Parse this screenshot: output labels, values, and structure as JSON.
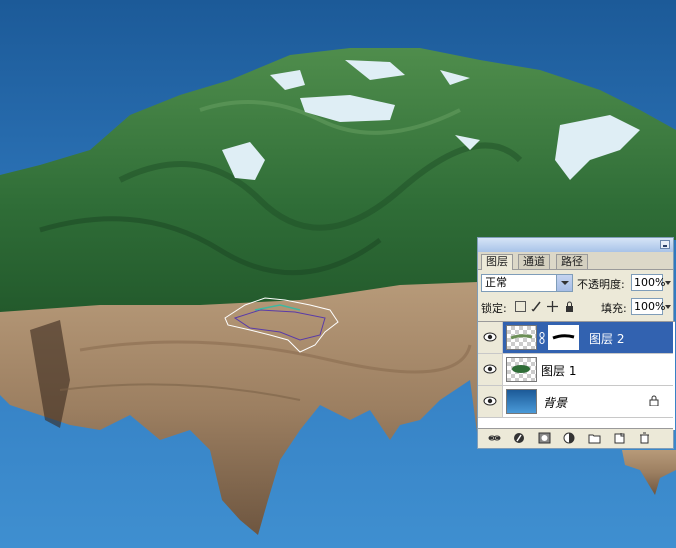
{
  "panel": {
    "tabs": [
      {
        "label": "图层",
        "active": true
      },
      {
        "label": "通道",
        "active": false
      },
      {
        "label": "路径",
        "active": false
      }
    ],
    "blend_mode": "正常",
    "opacity_label": "不透明度:",
    "opacity_value": "100%",
    "lock_label": "锁定:",
    "fill_label": "填充:",
    "fill_value": "100%",
    "layers": [
      {
        "name": "图层 2",
        "selected": true,
        "has_mask": true
      },
      {
        "name": "图层 1",
        "selected": false,
        "has_mask": false
      },
      {
        "name": "背景",
        "selected": false,
        "locked": true
      }
    ],
    "bottom_icons": [
      "link-icon",
      "fx-icon",
      "mask-icon",
      "adjustment-icon",
      "group-folder-icon",
      "new-layer-icon",
      "trash-icon"
    ]
  },
  "colors": {
    "selection_blue": "#3262b0",
    "panel_bg": "#ece9d8",
    "sky_top": "#1c5a98",
    "sky_bottom": "#3f8fd0"
  }
}
